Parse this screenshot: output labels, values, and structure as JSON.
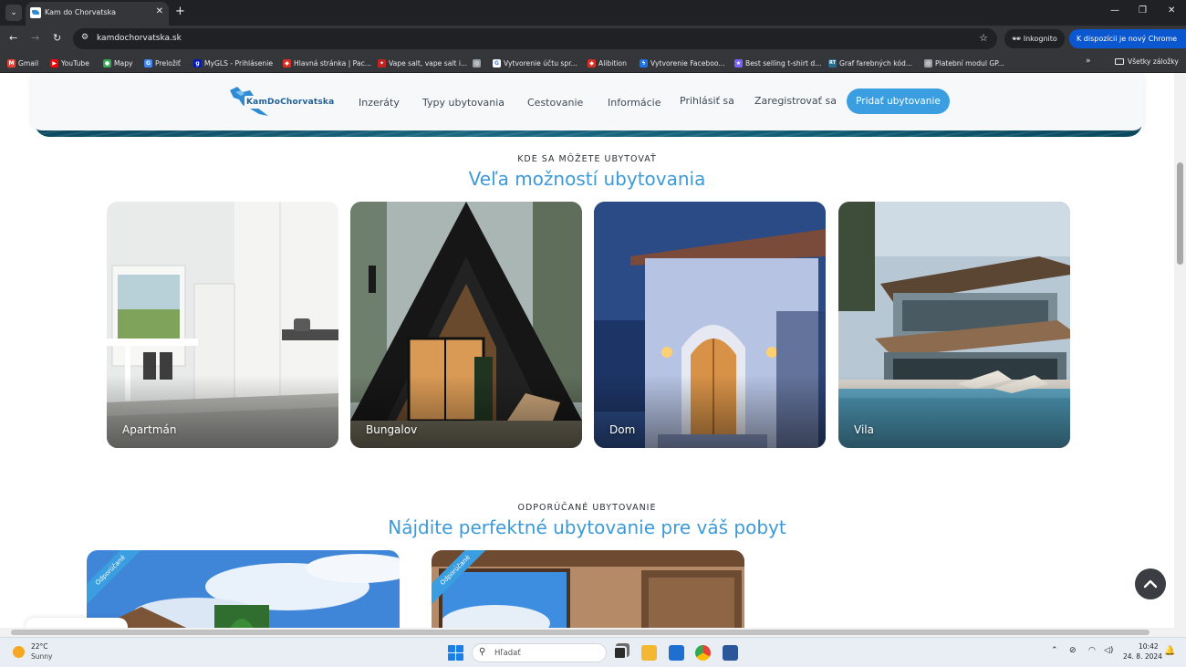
{
  "browser": {
    "tab_title": "Kam do Chorvatska",
    "tab_close": "✕",
    "new_tab": "+",
    "url": "kamdochorvatska.sk",
    "incognito_label": "Inkognito",
    "update_label": "K dispozícii je nový Chrome",
    "window_controls": [
      "—",
      "❐",
      "✕"
    ]
  },
  "bookmarks": {
    "items": [
      {
        "label": "Gmail",
        "icon": "gmail-icon",
        "color": "#ea4335",
        "glyph": "M"
      },
      {
        "label": "YouTube",
        "icon": "youtube-icon",
        "color": "#ff0000",
        "glyph": "▶"
      },
      {
        "label": "Mapy",
        "icon": "maps-icon",
        "color": "#34a853",
        "glyph": "●"
      },
      {
        "label": "Preložiť",
        "icon": "translate-icon",
        "color": "#4285f4",
        "glyph": "G"
      },
      {
        "label": "MyGLS - Prihlásenie",
        "icon": "gls-icon",
        "color": "#061ab1",
        "glyph": "g"
      },
      {
        "label": "Hlavná stránka | Pac...",
        "icon": "shield-icon",
        "color": "#d93025",
        "glyph": "◆"
      },
      {
        "label": "Vape salt, vape salt i...",
        "icon": "vape-icon",
        "color": "#c5221f",
        "glyph": "✦"
      },
      {
        "label": "",
        "icon": "globe-icon",
        "color": "#9aa0a6",
        "glyph": "◎"
      },
      {
        "label": "Vytvorenie účtu spr...",
        "icon": "google-icon",
        "color": "#ffffff",
        "glyph": "G"
      },
      {
        "label": "Alibition",
        "icon": "shield-icon",
        "color": "#d93025",
        "glyph": "◆"
      },
      {
        "label": "Vytvorenie Faceboo...",
        "icon": "bolt-icon",
        "color": "#1a73e8",
        "glyph": "ϟ"
      },
      {
        "label": "Best selling t-shirt d...",
        "icon": "star-icon",
        "color": "#7b61ff",
        "glyph": "★"
      },
      {
        "label": "Graf farebných kód...",
        "icon": "rt-icon",
        "color": "#2d6a8f",
        "glyph": "RT"
      },
      {
        "label": "Platební modul GP...",
        "icon": "globe-icon",
        "color": "#9aa0a6",
        "glyph": "◎"
      }
    ],
    "overflow": "»",
    "all_label": "Všetky záložky"
  },
  "navbar": {
    "logo_text": "KamDoChorvatska",
    "links": [
      {
        "label": "Inzeráty",
        "name": "nav-inzeraty"
      },
      {
        "label": "Typy ubytovania",
        "name": "nav-typy-ubytovania"
      },
      {
        "label": "Cestovanie",
        "name": "nav-cestovanie"
      },
      {
        "label": "Informácie",
        "name": "nav-informacie"
      },
      {
        "label": "Prihlásiť sa",
        "name": "nav-prihlasit-sa"
      },
      {
        "label": "Zaregistrovať sa",
        "name": "nav-zaregistrovat-sa"
      }
    ],
    "cta": "Pridať ubytovanie"
  },
  "accommodation": {
    "eyebrow": "KDE SA MÔŽETE UBYTOVAŤ",
    "heading": "Veľa možností ubytovania",
    "cards": [
      {
        "label": "Apartmán"
      },
      {
        "label": "Bungalov"
      },
      {
        "label": "Dom"
      },
      {
        "label": "Vila"
      }
    ]
  },
  "featured": {
    "eyebrow": "ODPORÚČANÉ UBYTOVANIE",
    "heading": "Nájdite perfektné ubytovanie pre váš pobyt",
    "ribbon": "Odporúčané"
  },
  "taskbar": {
    "temperature": "22°C",
    "weather": "Sunny",
    "search_placeholder": "Hľadať",
    "time": "10:42",
    "date": "24. 8. 2024"
  }
}
